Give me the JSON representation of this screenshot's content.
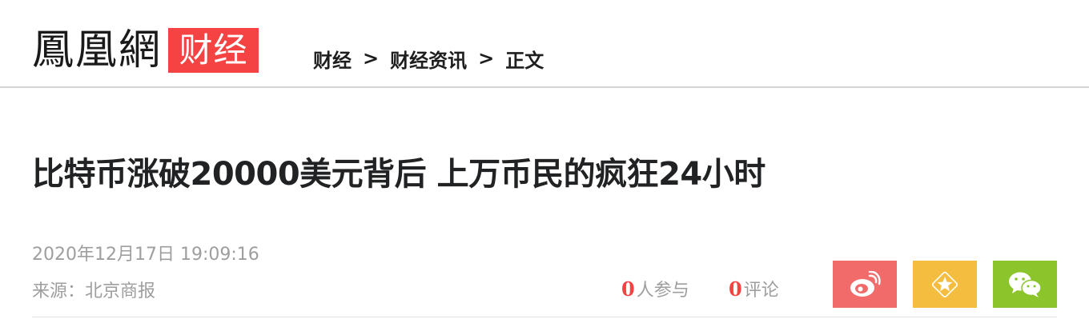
{
  "header": {
    "logo_text": "鳳凰網",
    "logo_badge": "财经",
    "breadcrumb": [
      {
        "label": "财经"
      },
      {
        "label": "财经资讯"
      },
      {
        "label": "正文"
      }
    ],
    "separator": ">"
  },
  "article": {
    "title": "比特币涨破20000美元背后 上万币民的疯狂24小时",
    "datetime": "2020年12月17日 19:09:16",
    "source": "来源：北京商报"
  },
  "stats": {
    "participants_count": "0",
    "participants_label": "人参与",
    "comments_count": "0",
    "comments_label": "评论"
  },
  "share": {
    "icons": [
      "weibo-icon",
      "star-icon",
      "wechat-icon"
    ],
    "colors": {
      "weibo": "#f16b6b",
      "favorite": "#f4bd3f",
      "wechat": "#8cc42c"
    }
  },
  "colors": {
    "brand_red": "#f54343",
    "title": "#212223",
    "meta": "#9e9e9e"
  }
}
